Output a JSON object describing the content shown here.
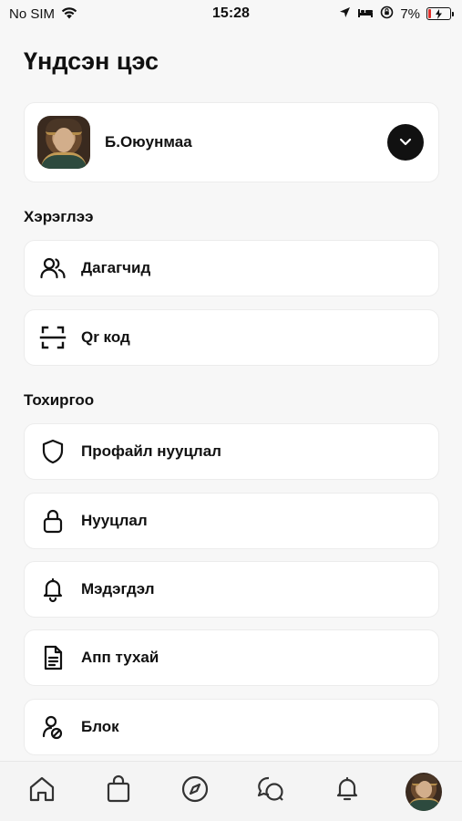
{
  "status_bar": {
    "carrier": "No SIM",
    "time": "15:28",
    "battery": "7%"
  },
  "page": {
    "title": "Үндсэн цэс"
  },
  "profile": {
    "name": "Б.Оюунмаа"
  },
  "sections": {
    "tools": {
      "title": "Хэрэглээ",
      "items": [
        {
          "label": "Дагагчид",
          "icon": "users-icon"
        },
        {
          "label": "Qr код",
          "icon": "qr-scan-icon"
        }
      ]
    },
    "settings": {
      "title": "Тохиргоо",
      "items": [
        {
          "label": "Профайл нууцлал",
          "icon": "shield-icon"
        },
        {
          "label": "Нууцлал",
          "icon": "lock-icon"
        },
        {
          "label": "Мэдэгдэл",
          "icon": "bell-icon"
        },
        {
          "label": "Апп тухай",
          "icon": "document-icon"
        },
        {
          "label": "Блок",
          "icon": "user-block-icon"
        }
      ]
    }
  },
  "tab_bar": {
    "tabs": [
      "home-icon",
      "shopping-bag-icon",
      "compass-icon",
      "chat-icon",
      "bell-icon",
      "profile-avatar"
    ]
  },
  "colors": {
    "background": "#f7f7f7",
    "card": "#ffffff",
    "text": "#111111",
    "battery_low": "#e0302b"
  }
}
